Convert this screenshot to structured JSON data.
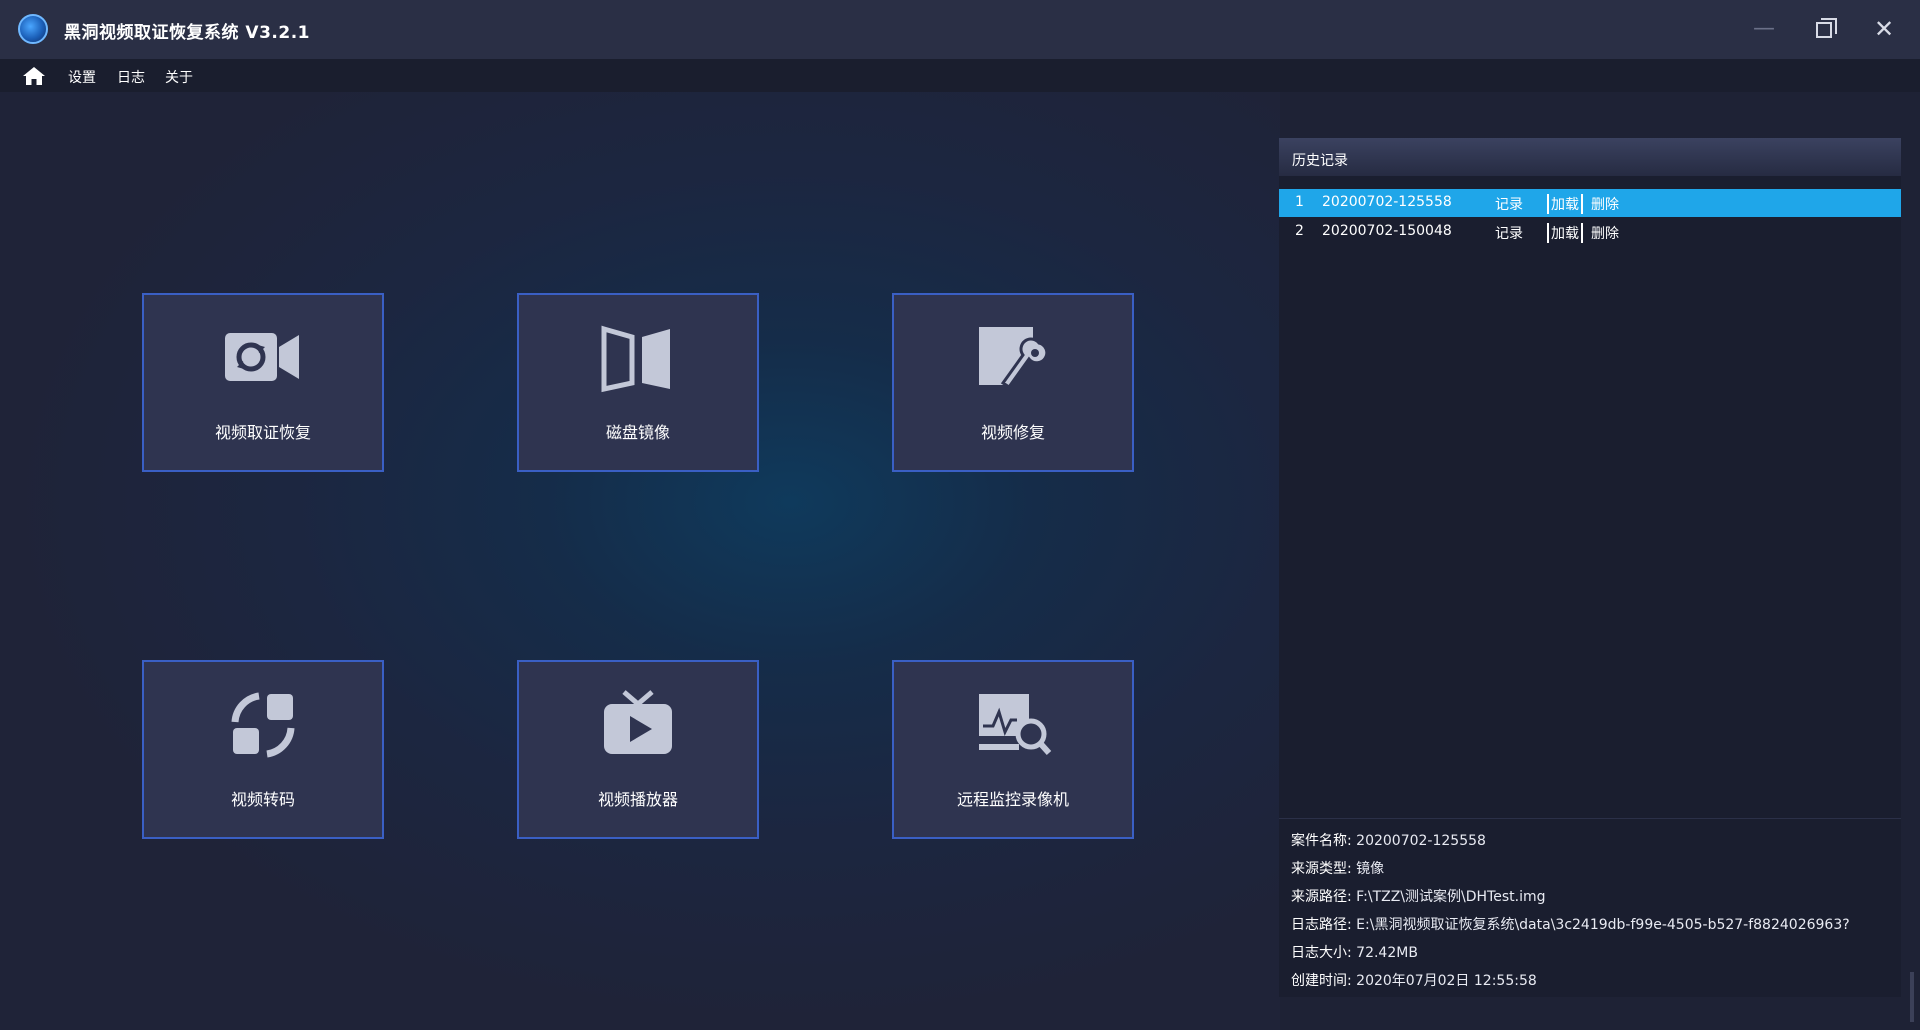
{
  "window": {
    "title": "黑洞视频取证恢复系统 V3.2.1",
    "minimize_label": "—",
    "close_label": "✕"
  },
  "menu": {
    "items": [
      "设置",
      "日志",
      "关于"
    ]
  },
  "tiles": [
    {
      "label": "视频取证恢复",
      "icon": "video-camera-icon"
    },
    {
      "label": "磁盘镜像",
      "icon": "disk-mirror-icon"
    },
    {
      "label": "视频修复",
      "icon": "edit-wrench-icon"
    },
    {
      "label": "视频转码",
      "icon": "transcode-icon"
    },
    {
      "label": "视频播放器",
      "icon": "tv-play-icon"
    },
    {
      "label": "远程监控录像机",
      "icon": "monitor-search-icon"
    }
  ],
  "history": {
    "title": "历史记录",
    "rows": [
      {
        "index": "1",
        "name": "20200702-125558",
        "record": "记录",
        "load": "加载",
        "delete": "删除",
        "selected": true
      },
      {
        "index": "2",
        "name": "20200702-150048",
        "record": "记录",
        "load": "加载",
        "delete": "删除",
        "selected": false
      }
    ]
  },
  "details": {
    "case_name": {
      "label": "案件名称:",
      "value": "20200702-125558"
    },
    "source_type": {
      "label": "来源类型:",
      "value": "镜像"
    },
    "source_path": {
      "label": "来源路径:",
      "value": "F:\\TZZ\\测试案例\\DHTest.img"
    },
    "log_path": {
      "label": "日志路径:",
      "value": "E:\\黑洞视频取证恢复系统\\data\\3c2419db-f99e-4505-b527-f8824026963?"
    },
    "log_size": {
      "label": "日志大小:",
      "value": "72.42MB"
    },
    "created_time": {
      "label": "创建时间:",
      "value": "2020年07月02日 12:55:58"
    }
  },
  "colors": {
    "accent": "#1fa6e9",
    "tile_border": "#3a5fc4",
    "tile_bg": "#2f3450"
  }
}
